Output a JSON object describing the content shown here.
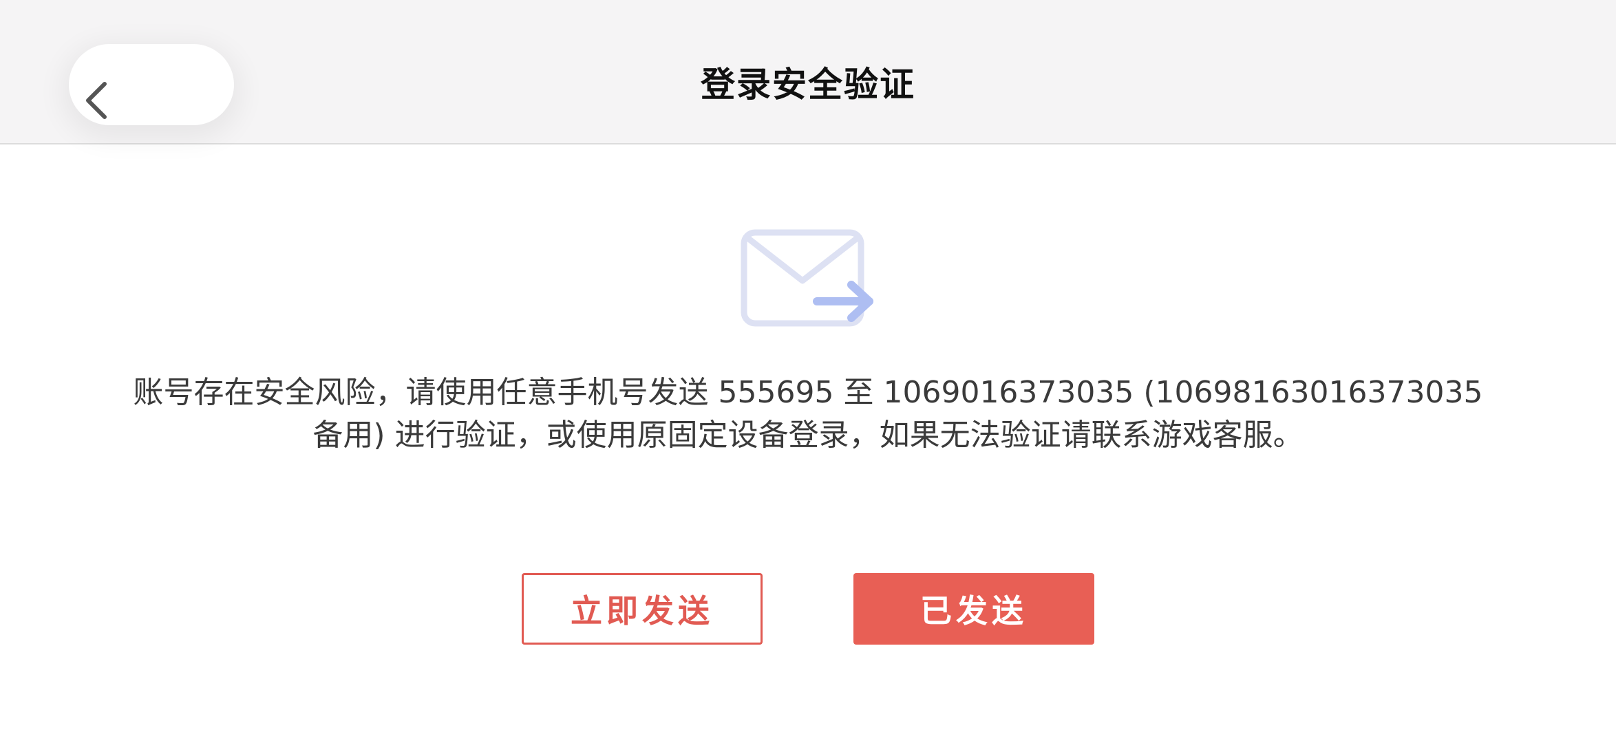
{
  "header": {
    "title": "登录安全验证",
    "back_icon": "chevron-left-icon"
  },
  "main": {
    "icon": "mail-send-icon",
    "message": "账号存在安全风险，请使用任意手机号发送 555695 至 1069016373035 (1069816301637303 5备用) 进行验证，或使用原固定设备登录，如果无法验证请联系游戏客服。",
    "message_line1": "账号存在安全风险，请使用任意手机号发送 555695 至 1069016373035 (10698163016373035",
    "message_line2": "备用) 进行验证，或使用原固定设备登录，如果无法验证请联系游戏客服。"
  },
  "actions": {
    "send_now_label": "立即发送",
    "sent_label": "已发送"
  },
  "colors": {
    "accent": "#e85f55",
    "header_bg": "#f5f4f5",
    "text": "#3a3a3a"
  }
}
